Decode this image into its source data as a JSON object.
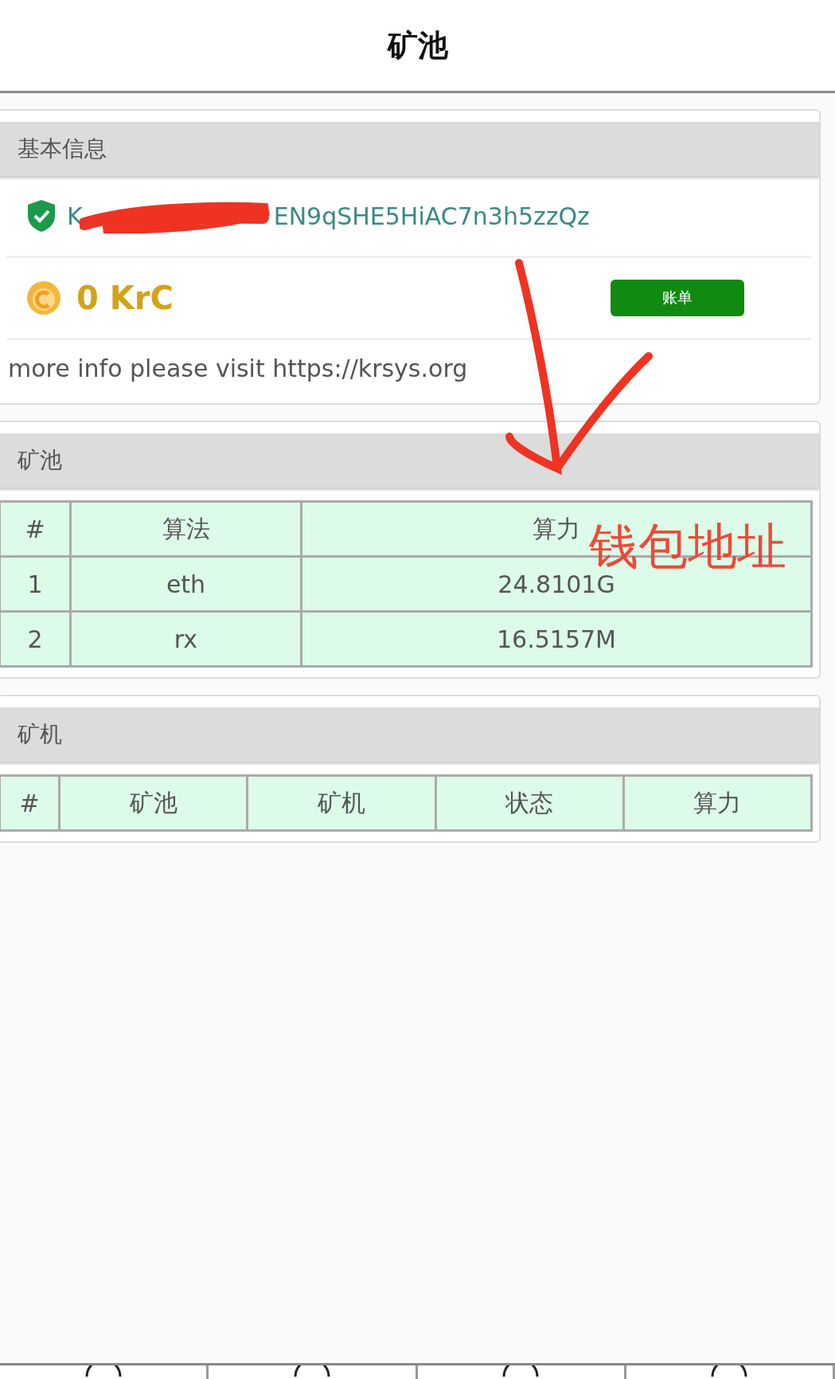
{
  "header": {
    "title": "矿池"
  },
  "info_card": {
    "title": "基本信息",
    "address_start": "K",
    "address_end": "EN9qSHE5HiAC7n3h5zzQz",
    "balance": "0 KrC",
    "bill_button": "账单",
    "note": "more info please visit https://krsys.org"
  },
  "pool_card": {
    "title": "矿池",
    "columns": [
      "#",
      "算法",
      "算力"
    ],
    "rows": [
      [
        "1",
        "eth",
        "24.8101G"
      ],
      [
        "2",
        "rx",
        "16.5157M"
      ]
    ]
  },
  "miner_card": {
    "title": "矿机",
    "columns": [
      "#",
      "矿池",
      "矿机",
      "状态",
      "算力"
    ]
  },
  "bottom_nav": {
    "items": [
      {
        "kind": "tab"
      },
      {
        "kind": "tab"
      },
      {
        "kind": "tab"
      },
      {
        "kind": "tab"
      }
    ]
  },
  "annotation": {
    "text": "钱包地址"
  }
}
